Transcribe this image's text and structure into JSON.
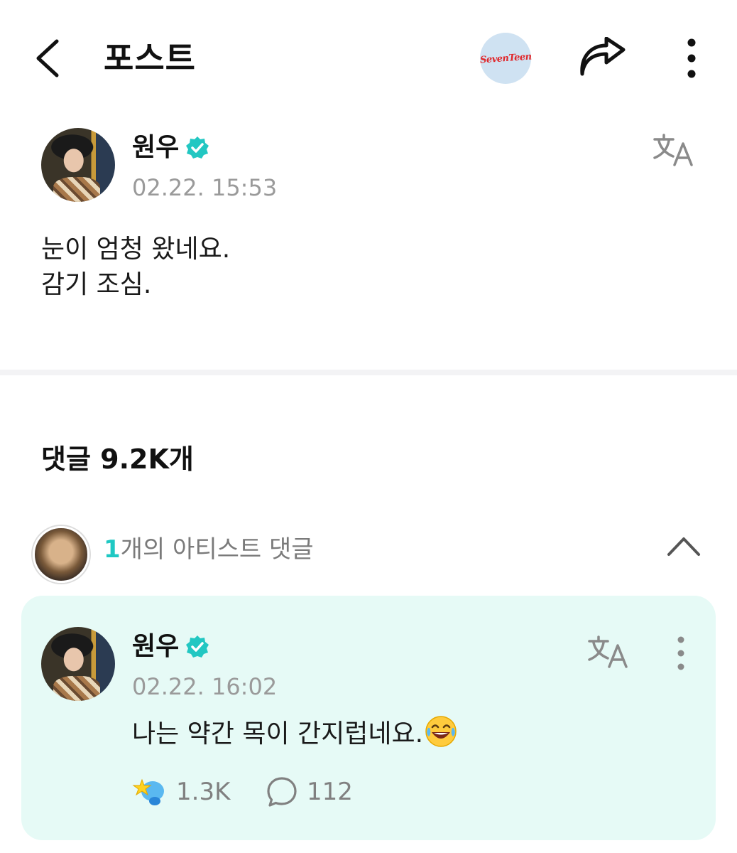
{
  "header": {
    "title": "포스트",
    "community_logo_text": "SevenTeen",
    "back_icon": "chevron-left-icon",
    "share_icon": "share-icon",
    "more_icon": "more-vertical-icon"
  },
  "post": {
    "author": "원우",
    "verified": true,
    "timestamp": "02.22. 15:53",
    "body": "눈이 엄청 왔네요.\n감기 조심."
  },
  "comments": {
    "label": "댓글 9.2K개",
    "artist_comments": {
      "count": "1",
      "label": "개의 아티스트 댓글"
    },
    "items": [
      {
        "author": "원우",
        "verified": true,
        "timestamp": "02.22. 16:02",
        "text": "나는 약간 목이 간지럽네요.",
        "emoji": "face-with-tears-of-joy",
        "reactions": "1.3K",
        "replies": "112"
      }
    ]
  },
  "colors": {
    "accent": "#1fc8c3",
    "card_bg": "#e6faf6",
    "logo_bg": "#cfe2f2",
    "logo_text": "#e0282c"
  }
}
